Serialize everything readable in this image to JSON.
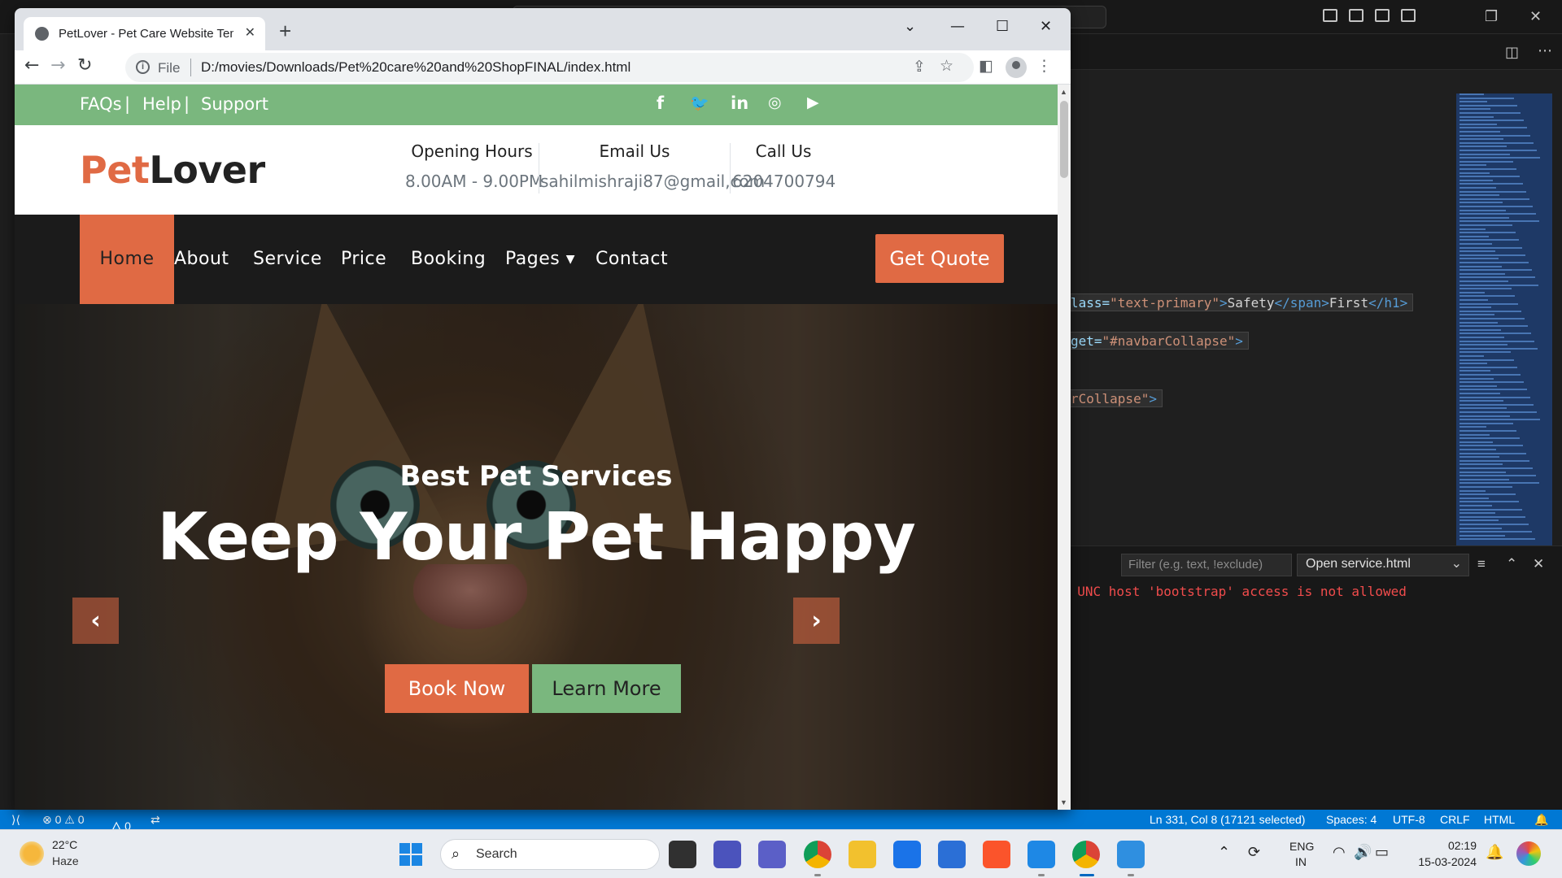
{
  "vscode": {
    "code_lines": [
      {
        "parts": [
          [
            "c-attr",
            "lass="
          ],
          [
            "c-str",
            "\"text-primary\""
          ],
          [
            "c-tag",
            ">"
          ],
          [
            "c-txt",
            "Safety"
          ],
          [
            "c-tag",
            "</span>"
          ],
          [
            "c-txt",
            "First"
          ],
          [
            "c-tag",
            "</h1>"
          ]
        ]
      },
      {
        "parts": [
          [
            "c-attr",
            "get="
          ],
          [
            "c-str",
            "\"#navbarCollapse\""
          ],
          [
            "c-tag",
            ">"
          ]
        ]
      },
      {
        "parts": [
          [
            "c-str",
            "rCollapse\""
          ],
          [
            "c-tag",
            ">"
          ]
        ]
      }
    ],
    "panel": {
      "filter_placeholder": "Filter (e.g. text, !exclude)",
      "output_channel": "Open service.html",
      "error_text": ": UNC host 'bootstrap' access is not allowed"
    },
    "statusbar": {
      "problems": "⊗ 0 ⚠ 0",
      "ports": "🜂 0",
      "cursor": "Ln 331, Col 8 (17121 selected)",
      "spaces": "Spaces: 4",
      "encoding": "UTF-8",
      "eol": "CRLF",
      "language": "HTML"
    }
  },
  "browser": {
    "tab_title": "PetLover - Pet Care Website Template",
    "url_scheme": "File",
    "url": "D:/movies/Downloads/Pet%20care%20and%20ShopFINAL/index.html"
  },
  "site": {
    "colors": {
      "primary": "#e06a44",
      "secondary": "#7ab77e",
      "dark": "#1b1b1b"
    },
    "topbar": {
      "links": [
        "FAQs",
        "Help",
        "Support"
      ],
      "separator": "|",
      "social_icons": [
        "facebook-icon",
        "twitter-icon",
        "linkedin-icon",
        "instagram-icon",
        "youtube-icon"
      ]
    },
    "brand": {
      "part1": "Pet",
      "part2": "Lover"
    },
    "info": [
      {
        "label": "Opening Hours",
        "value": "8.00AM - 9.00PM"
      },
      {
        "label": "Email Us",
        "value": "sahilmishraji87@gmail,com"
      },
      {
        "label": "Call Us",
        "value": "6204700794"
      }
    ],
    "nav": {
      "items": [
        "Home",
        "About",
        "Service",
        "Price",
        "Booking",
        "Pages",
        "Contact"
      ],
      "active": "Home",
      "quote_button": "Get Quote"
    },
    "hero": {
      "subtitle": "Best Pet Services",
      "title": "Keep Your Pet Happy",
      "primary_button": "Book Now",
      "secondary_button": "Learn More"
    }
  },
  "taskbar": {
    "weather": {
      "temp": "22°C",
      "condition": "Haze"
    },
    "search_placeholder": "Search",
    "lang_line1": "ENG",
    "lang_line2": "IN",
    "time": "02:19",
    "date": "15-03-2024"
  }
}
